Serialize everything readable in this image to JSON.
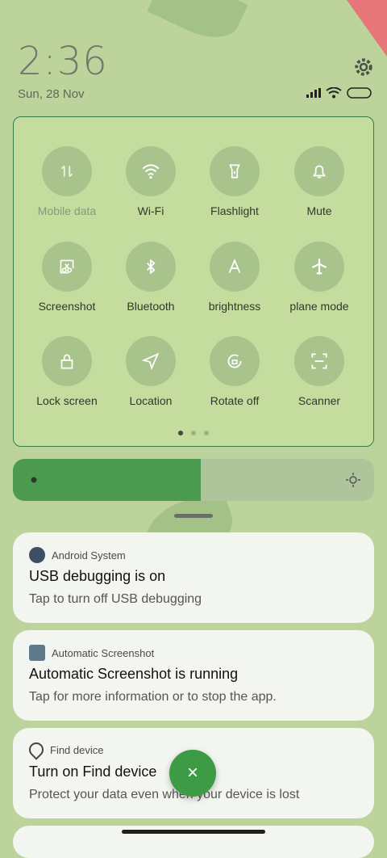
{
  "status": {
    "time": "2:36",
    "date": "Sun, 28 Nov"
  },
  "quick_tiles": [
    {
      "label": "Mobile data",
      "icon": "mobile-data-icon",
      "enabled": false
    },
    {
      "label": "Wi-Fi",
      "icon": "wifi-icon",
      "enabled": true
    },
    {
      "label": "Flashlight",
      "icon": "flashlight-icon",
      "enabled": true
    },
    {
      "label": "Mute",
      "icon": "bell-icon",
      "enabled": true
    },
    {
      "label": "Screenshot",
      "icon": "screenshot-icon",
      "enabled": true
    },
    {
      "label": "Bluetooth",
      "icon": "bluetooth-icon",
      "enabled": true
    },
    {
      "label": "brightness",
      "icon": "auto-brightness-icon",
      "enabled": true
    },
    {
      "label": "plane mode",
      "icon": "airplane-icon",
      "enabled": true
    },
    {
      "label": "Lock screen",
      "icon": "lock-icon",
      "enabled": true
    },
    {
      "label": "Location",
      "icon": "location-icon",
      "enabled": true
    },
    {
      "label": "Rotate off",
      "icon": "rotate-lock-icon",
      "enabled": true
    },
    {
      "label": "Scanner",
      "icon": "scanner-icon",
      "enabled": true
    }
  ],
  "page_indicator": {
    "pages": 3,
    "current": 1
  },
  "brightness": {
    "level_fraction": 0.52
  },
  "notifications": [
    {
      "source": "Android System",
      "title": "USB debugging is on",
      "body": "Tap to turn off USB debugging"
    },
    {
      "source": "Automatic Screenshot",
      "title": "Automatic Screenshot is running",
      "body": "Tap for more information or to stop the app."
    },
    {
      "source": "Find device",
      "title": "Turn on Find device",
      "body": "Protect your data even when your device is lost"
    }
  ],
  "fab": {
    "label": "×"
  },
  "colors": {
    "accent": "#4b9a4f",
    "panel_border": "#3c7a46",
    "background": "#bcd39c"
  }
}
